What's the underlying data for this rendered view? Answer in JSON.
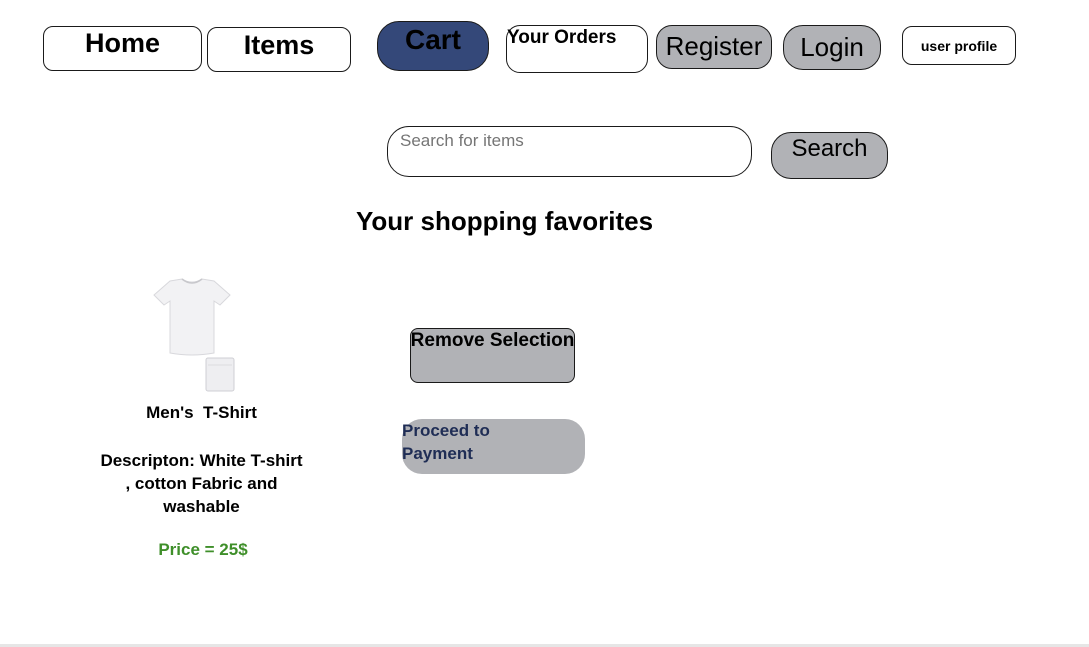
{
  "nav": {
    "home_label": "Home",
    "items_label": "Items",
    "cart_label": "Cart",
    "orders_label": "Your Orders",
    "register_label": "Register",
    "login_label": "Login",
    "profile_label": "user profile"
  },
  "search": {
    "placeholder": "Search for items",
    "button_label": "Search"
  },
  "favorites": {
    "heading": "Your shopping favorites",
    "item": {
      "image_icon": "white-tshirt-image",
      "name": "Men's  T-Shirt",
      "description": "Descripton: White T-shirt , cotton Fabric and washable",
      "price": "Price = 25$"
    },
    "remove_label": "Remove Selection",
    "proceed_label": "Proceed to Payment"
  },
  "colors": {
    "cart_bg": "#344879",
    "button_gray": "#b1b2b6",
    "price_green": "#3f8f2a",
    "proceed_text": "#1f2d55"
  }
}
